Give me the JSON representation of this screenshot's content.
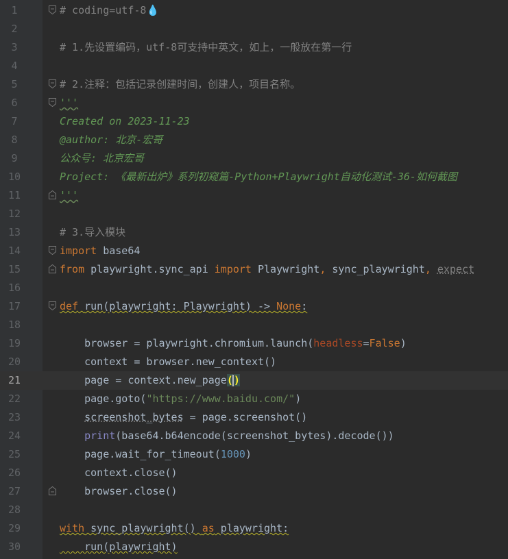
{
  "editor": {
    "current_line": 21,
    "lines": [
      {
        "n": "1",
        "fold": "start",
        "parts": [
          {
            "t": "# coding=utf-8",
            "c": "comment"
          },
          {
            "t": "💧",
            "c": "comment"
          }
        ]
      },
      {
        "n": "2",
        "parts": []
      },
      {
        "n": "3",
        "parts": [
          {
            "t": "# 1.先设置编码，utf-8可支持中英文，如上，一般放在第一行",
            "c": "comment"
          }
        ]
      },
      {
        "n": "4",
        "parts": []
      },
      {
        "n": "5",
        "fold": "start",
        "parts": [
          {
            "t": "# 2.注释：包括记录创建时间，创建人，项目名称。",
            "c": "comment"
          }
        ]
      },
      {
        "n": "6",
        "fold": "start",
        "parts": [
          {
            "t": "'''",
            "c": "doc sqg"
          }
        ]
      },
      {
        "n": "7",
        "parts": [
          {
            "t": "Created on 2023-11-23",
            "c": "doc"
          }
        ]
      },
      {
        "n": "8",
        "parts": [
          {
            "t": "@author: 北京-宏哥",
            "c": "doc"
          }
        ]
      },
      {
        "n": "9",
        "parts": [
          {
            "t": "公众号: 北京宏哥",
            "c": "doc"
          }
        ]
      },
      {
        "n": "10",
        "parts": [
          {
            "t": "Project: 《最新出炉》系列初窥篇-Python+Playwright自动化测试-36-如何截图",
            "c": "doc"
          }
        ]
      },
      {
        "n": "11",
        "fold": "end",
        "parts": [
          {
            "t": "'''",
            "c": "doc sqg"
          }
        ]
      },
      {
        "n": "12",
        "parts": []
      },
      {
        "n": "13",
        "parts": [
          {
            "t": "# 3.导入模块",
            "c": "comment"
          }
        ]
      },
      {
        "n": "14",
        "fold": "start",
        "parts": [
          {
            "t": "import",
            "c": "kw"
          },
          {
            "t": " base64",
            "c": ""
          }
        ]
      },
      {
        "n": "15",
        "fold": "end",
        "parts": [
          {
            "t": "from",
            "c": "kw"
          },
          {
            "t": " playwright.sync_api ",
            "c": ""
          },
          {
            "t": "import",
            "c": "kw"
          },
          {
            "t": " Playwright",
            "c": ""
          },
          {
            "t": ",",
            "c": "kw"
          },
          {
            "t": " sync_playwright",
            "c": ""
          },
          {
            "t": ",",
            "c": "kw"
          },
          {
            "t": " ",
            "c": ""
          },
          {
            "t": "expect",
            "c": "comment dotted"
          }
        ]
      },
      {
        "n": "16",
        "parts": []
      },
      {
        "n": "17",
        "fold": "start",
        "parts": [
          {
            "t": "def",
            "c": "kw sq"
          },
          {
            "t": " ",
            "c": "sq"
          },
          {
            "t": "run",
            "c": "fn sq"
          },
          {
            "t": "(playwright: Playwright) -> ",
            "c": "sq"
          },
          {
            "t": "None",
            "c": "kw sq"
          },
          {
            "t": ":",
            "c": "sq"
          }
        ]
      },
      {
        "n": "18",
        "parts": []
      },
      {
        "n": "19",
        "parts": [
          {
            "t": "    browser = playwright.chromium.launch(",
            "c": ""
          },
          {
            "t": "headless",
            "c": "param"
          },
          {
            "t": "=",
            "c": ""
          },
          {
            "t": "False",
            "c": "kw"
          },
          {
            "t": ")",
            "c": ""
          }
        ]
      },
      {
        "n": "20",
        "parts": [
          {
            "t": "    context = browser.new_context()",
            "c": ""
          }
        ]
      },
      {
        "n": "21",
        "parts": [
          {
            "t": "    page = context.new_page",
            "c": ""
          },
          {
            "t": "(",
            "c": "match"
          },
          {
            "t": ")",
            "c": "match"
          }
        ]
      },
      {
        "n": "22",
        "parts": [
          {
            "t": "    page.goto(",
            "c": ""
          },
          {
            "t": "\"https://www.baidu.com/\"",
            "c": "str"
          },
          {
            "t": ")",
            "c": ""
          }
        ]
      },
      {
        "n": "23",
        "parts": [
          {
            "t": "    ",
            "c": ""
          },
          {
            "t": "screenshot_bytes",
            "c": "dotted"
          },
          {
            "t": " = page.screenshot()",
            "c": ""
          }
        ]
      },
      {
        "n": "24",
        "parts": [
          {
            "t": "    ",
            "c": ""
          },
          {
            "t": "print",
            "c": "builtin"
          },
          {
            "t": "(base64.b64encode(screenshot_bytes).decode())",
            "c": ""
          }
        ]
      },
      {
        "n": "25",
        "parts": [
          {
            "t": "    page.wait_for_timeout(",
            "c": ""
          },
          {
            "t": "1000",
            "c": "num"
          },
          {
            "t": ")",
            "c": ""
          }
        ]
      },
      {
        "n": "26",
        "parts": [
          {
            "t": "    context.close()",
            "c": ""
          }
        ]
      },
      {
        "n": "27",
        "fold": "end",
        "parts": [
          {
            "t": "    browser.close()",
            "c": ""
          }
        ]
      },
      {
        "n": "28",
        "parts": []
      },
      {
        "n": "29",
        "parts": [
          {
            "t": "with",
            "c": "kw sq"
          },
          {
            "t": " sync_playwright() ",
            "c": "sq"
          },
          {
            "t": "as",
            "c": "kw sq"
          },
          {
            "t": " playwright:",
            "c": "sq"
          }
        ]
      },
      {
        "n": "30",
        "parts": [
          {
            "t": "    run(playwright)",
            "c": "sq"
          }
        ]
      }
    ]
  },
  "colors": {
    "background": "#2b2b2b",
    "gutter": "#313335",
    "current_line": "#323232",
    "comment": "#808080",
    "docstring": "#629755",
    "keyword": "#cc7832",
    "string": "#6a8759",
    "number": "#6897bb"
  }
}
